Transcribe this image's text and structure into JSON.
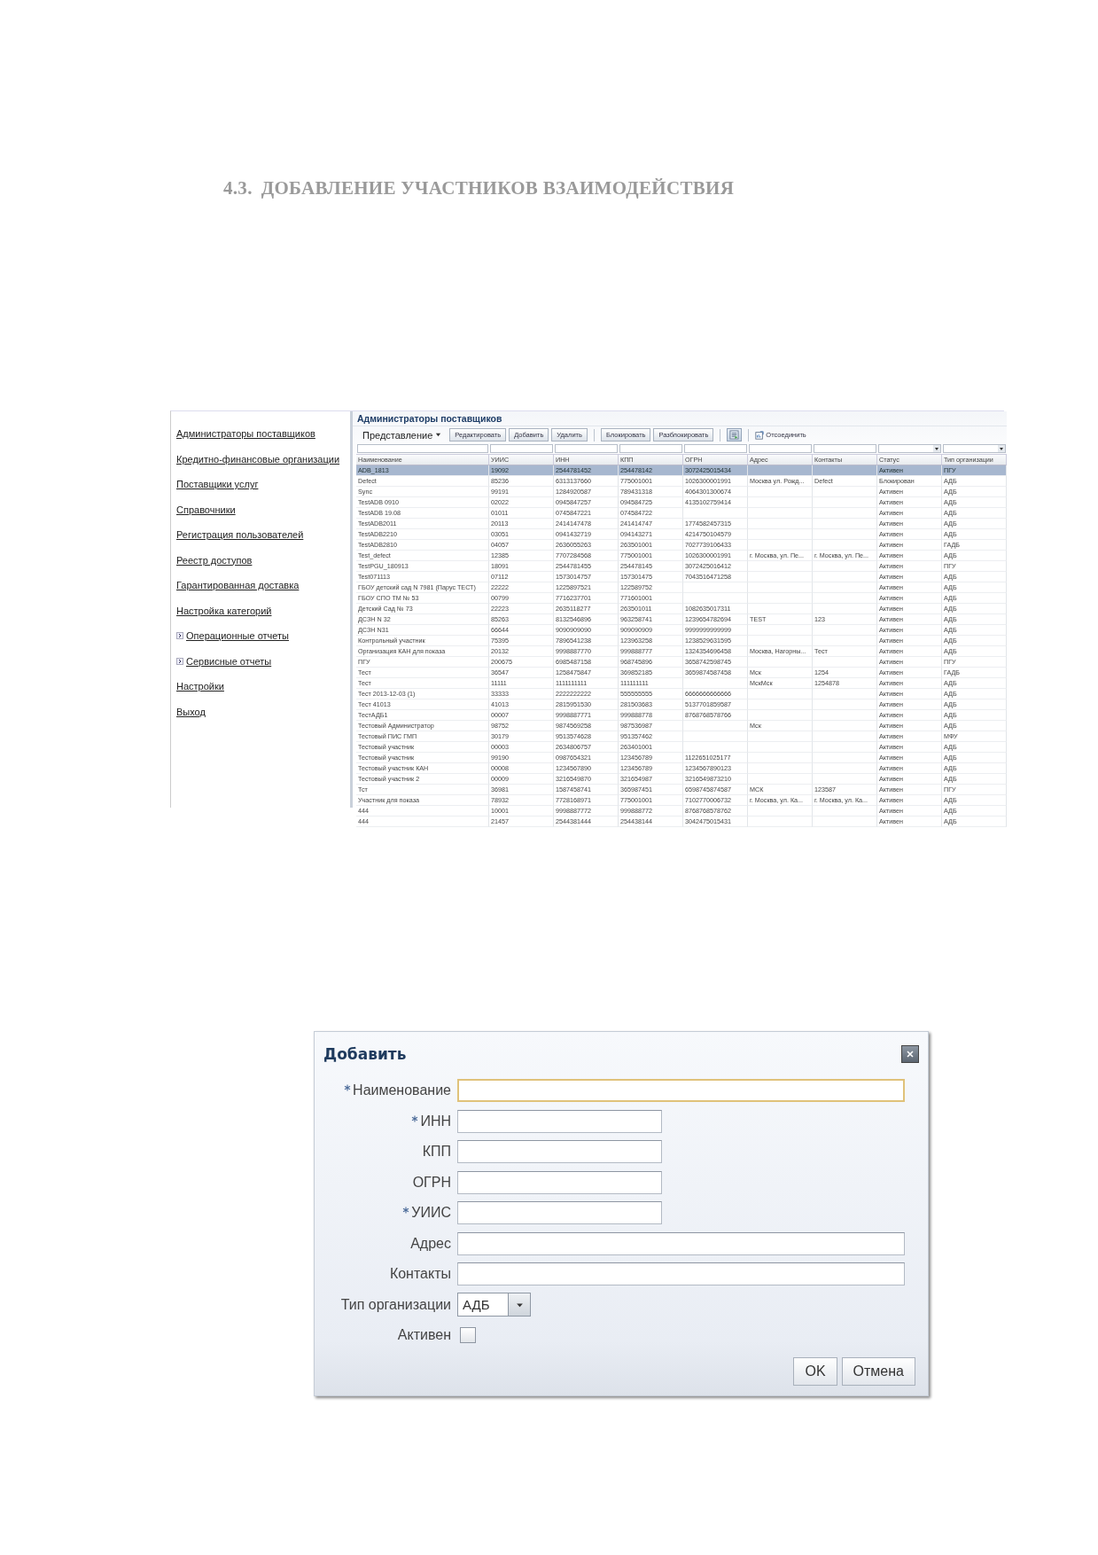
{
  "heading": {
    "number": "4.3.",
    "title": "ДОБАВЛЕНИЕ УЧАСТНИКОВ ВЗАИМОДЕЙСТВИЯ"
  },
  "sidebar": {
    "items": [
      {
        "label": "Администраторы поставщиков",
        "expandable": false
      },
      {
        "label": "Кредитно-финансовые организации",
        "expandable": false
      },
      {
        "label": "Поставщики услуг",
        "expandable": false
      },
      {
        "label": "Справочники",
        "expandable": false
      },
      {
        "label": "Регистрация пользователей",
        "expandable": false
      },
      {
        "label": "Реестр доступов",
        "expandable": false
      },
      {
        "label": "Гарантированная доставка",
        "expandable": false
      },
      {
        "label": "Настройка категорий",
        "expandable": false
      },
      {
        "label": "Операционные отчеты",
        "expandable": true
      },
      {
        "label": "Сервисные отчеты",
        "expandable": true
      },
      {
        "label": "Настройки",
        "expandable": false
      },
      {
        "label": "Выход",
        "expandable": false
      }
    ]
  },
  "panel": {
    "title": "Администраторы поставщиков",
    "toolbar": [
      {
        "kind": "menu",
        "label": "Представление"
      },
      {
        "kind": "button",
        "label": "Редактировать"
      },
      {
        "kind": "button",
        "label": "Добавить"
      },
      {
        "kind": "button",
        "label": "Удалить"
      },
      {
        "kind": "separator"
      },
      {
        "kind": "button",
        "label": "Блокировать"
      },
      {
        "kind": "button",
        "label": "Разблокировать"
      },
      {
        "kind": "separator"
      },
      {
        "kind": "icon"
      },
      {
        "kind": "separator"
      },
      {
        "kind": "icon_label",
        "label": "Отсоединить"
      }
    ],
    "table": {
      "columns": [
        {
          "label": "Наименование",
          "kind": "text"
        },
        {
          "label": "УИИС",
          "kind": "text"
        },
        {
          "label": "ИНН",
          "kind": "text"
        },
        {
          "label": "КПП",
          "kind": "text"
        },
        {
          "label": "ОГРН",
          "kind": "text"
        },
        {
          "label": "Адрес",
          "kind": "text"
        },
        {
          "label": "Контакты",
          "kind": "text"
        },
        {
          "label": "Статус",
          "kind": "select"
        },
        {
          "label": "Тип организации",
          "kind": "select"
        }
      ],
      "rows": [
        {
          "selected": true,
          "cells": [
            "ADB_1813",
            "19092",
            "2544781452",
            "254478142",
            "3072425015434",
            null,
            null,
            "Активен",
            "ПГУ"
          ]
        },
        {
          "selected": false,
          "cells": [
            "Defect",
            "85236",
            "6313137660",
            "775001001",
            "1026300001991",
            "Москва ул. Рожд...",
            "Defect",
            "Блокирован",
            "АДБ"
          ]
        },
        {
          "selected": false,
          "cells": [
            "Sync",
            "99191",
            "1284920587",
            "789431318",
            "4064301300674",
            null,
            null,
            "Активен",
            "АДБ"
          ]
        },
        {
          "selected": false,
          "cells": [
            "TestADB 0910",
            "02022",
            "0945847257",
            "094584725",
            "4135102759414",
            null,
            null,
            "Активен",
            "АДБ"
          ]
        },
        {
          "selected": false,
          "cells": [
            "TestADB 19.08",
            "01011",
            "0745847221",
            "074584722",
            null,
            null,
            null,
            "Активен",
            "АДБ"
          ]
        },
        {
          "selected": false,
          "cells": [
            "TestADB2011",
            "20113",
            "2414147478",
            "241414747",
            "1774582457315",
            null,
            null,
            "Активен",
            "АДБ"
          ]
        },
        {
          "selected": false,
          "cells": [
            "TestADB2210",
            "03051",
            "0941432719",
            "094143271",
            "4214750104579",
            null,
            null,
            "Активен",
            "АДБ"
          ]
        },
        {
          "selected": false,
          "cells": [
            "TestADB2810",
            "04057",
            "2636055263",
            "263501001",
            "7027739106433",
            null,
            null,
            "Активен",
            "ГАДБ"
          ]
        },
        {
          "selected": false,
          "cells": [
            "Test_defect",
            "12385",
            "7707284568",
            "775001001",
            "1026300001991",
            "г. Москва, ул. Пе...",
            "г. Москва, ул. Пе...",
            "Активен",
            "АДБ"
          ]
        },
        {
          "selected": false,
          "cells": [
            "TestPGU_180913",
            "18091",
            "2544781455",
            "254478145",
            "3072425016412",
            null,
            null,
            "Активен",
            "ПГУ"
          ]
        },
        {
          "selected": false,
          "cells": [
            "Test071113",
            "07112",
            "1573014757",
            "157301475",
            "7043516471258",
            null,
            null,
            "Активен",
            "АДБ"
          ]
        },
        {
          "selected": false,
          "cells": [
            "ГБОУ детский сад N 7981 (Парус ТЕСТ)",
            "22222",
            "1225897521",
            "122589752",
            null,
            null,
            null,
            "Активен",
            "АДБ"
          ]
        },
        {
          "selected": false,
          "cells": [
            "ГБОУ СПО ТМ № 53",
            "00799",
            "7716237701",
            "771601001",
            null,
            null,
            null,
            "Активен",
            "АДБ"
          ]
        },
        {
          "selected": false,
          "cells": [
            "Детский Сад № 73",
            "22223",
            "2635118277",
            "263501011",
            "1082635017311",
            null,
            null,
            "Активен",
            "АДБ"
          ]
        },
        {
          "selected": false,
          "cells": [
            "ДСЗН N 32",
            "85263",
            "8132546896",
            "963258741",
            "1239654782694",
            "TEST",
            "123",
            "Активен",
            "АДБ"
          ]
        },
        {
          "selected": false,
          "cells": [
            "ДСЗН N31",
            "66644",
            "9090909090",
            "909090909",
            "9999999999999",
            null,
            null,
            "Активен",
            "АДБ"
          ]
        },
        {
          "selected": false,
          "cells": [
            "Контрольный участник",
            "75395",
            "7896541238",
            "123963258",
            "1238529631595",
            null,
            null,
            "Активен",
            "АДБ"
          ]
        },
        {
          "selected": false,
          "cells": [
            "Организация КАН для показа",
            "20132",
            "9998887770",
            "999888777",
            "1324354696458",
            "Москва, Нагорны...",
            "Тест",
            "Активен",
            "АДБ"
          ]
        },
        {
          "selected": false,
          "cells": [
            "ПГУ",
            "200675",
            "6985487158",
            "968745896",
            "3658742598745",
            null,
            null,
            "Активен",
            "ПГУ"
          ]
        },
        {
          "selected": false,
          "cells": [
            "Тест",
            "36547",
            "1258475847",
            "369852185",
            "3659874587458",
            "Мск",
            "1254",
            "Активен",
            "ГАДБ"
          ]
        },
        {
          "selected": false,
          "cells": [
            "Тест",
            "11111",
            "1111111111",
            "111111111",
            null,
            "МскМск",
            "1254878",
            "Активен",
            "АДБ"
          ]
        },
        {
          "selected": false,
          "cells": [
            "Тест 2013-12-03 (1)",
            "33333",
            "2222222222",
            "555555555",
            "6666666666666",
            null,
            null,
            "Активен",
            "АДБ"
          ]
        },
        {
          "selected": false,
          "cells": [
            "Тест 41013",
            "41013",
            "2815951530",
            "281503683",
            "5137701859587",
            null,
            null,
            "Активен",
            "АДБ"
          ]
        },
        {
          "selected": false,
          "cells": [
            "ТестАДБ1",
            "00007",
            "9998887771",
            "999888778",
            "8768768578766",
            null,
            null,
            "Активен",
            "АДБ"
          ]
        },
        {
          "selected": false,
          "cells": [
            "Тестовый Администратор",
            "98752",
            "9874569258",
            "987536987",
            null,
            "Мск",
            null,
            "Активен",
            "АДБ"
          ]
        },
        {
          "selected": false,
          "cells": [
            "Тестовый ПИС ГМП",
            "30179",
            "9513574628",
            "951357462",
            null,
            null,
            null,
            "Активен",
            "МФУ"
          ]
        },
        {
          "selected": false,
          "cells": [
            "Тестовый участник",
            "00003",
            "2634806757",
            "263401001",
            null,
            null,
            null,
            "Активен",
            "АДБ"
          ]
        },
        {
          "selected": false,
          "cells": [
            "Тестовый участник",
            "99190",
            "0987654321",
            "123456789",
            "1122651025177",
            null,
            null,
            "Активен",
            "АДБ"
          ]
        },
        {
          "selected": false,
          "cells": [
            "Тестовый участник КАН",
            "00008",
            "1234567890",
            "123456789",
            "1234567890123",
            null,
            null,
            "Активен",
            "АДБ"
          ]
        },
        {
          "selected": false,
          "cells": [
            "Тестовый участник 2",
            "00009",
            "3216549870",
            "321654987",
            "3216549873210",
            null,
            null,
            "Активен",
            "АДБ"
          ]
        },
        {
          "selected": false,
          "cells": [
            "Тст",
            "36981",
            "1587458741",
            "365987451",
            "6598745874587",
            "МСК",
            "123587",
            "Активен",
            "ПГУ"
          ]
        },
        {
          "selected": false,
          "cells": [
            "Участник для показа",
            "78932",
            "7728168971",
            "775001001",
            "7102770006732",
            "г. Москва, ул. Ка...",
            "г. Москва, ул. Ка...",
            "Активен",
            "АДБ"
          ]
        },
        {
          "selected": false,
          "cells": [
            "444",
            "10001",
            "9998887772",
            "999888772",
            "8768768578762",
            null,
            null,
            "Активен",
            "АДБ"
          ]
        },
        {
          "selected": false,
          "cells": [
            "444",
            "21457",
            "2544381444",
            "254438144",
            "3042475015431",
            null,
            null,
            "Активен",
            "АДБ"
          ]
        }
      ]
    }
  },
  "dialog": {
    "title": "Добавить",
    "fields": [
      {
        "kind": "text",
        "label": "Наименование",
        "required": true,
        "wide": true,
        "focused": true
      },
      {
        "kind": "text",
        "label": "ИНН",
        "required": true,
        "wide": false,
        "focused": false
      },
      {
        "kind": "text",
        "label": "КПП",
        "required": false,
        "wide": false,
        "focused": false
      },
      {
        "kind": "text",
        "label": "ОГРН",
        "required": false,
        "wide": false,
        "focused": false
      },
      {
        "kind": "text",
        "label": "УИИС",
        "required": true,
        "wide": false,
        "focused": false
      },
      {
        "kind": "text",
        "label": "Адрес",
        "required": false,
        "wide": true,
        "focused": false
      },
      {
        "kind": "text",
        "label": "Контакты",
        "required": false,
        "wide": true,
        "focused": false
      },
      {
        "kind": "select",
        "label": "Тип организации",
        "required": false,
        "value": "АДБ"
      },
      {
        "kind": "checkbox",
        "label": "Активен",
        "required": false,
        "checked": false
      }
    ],
    "buttons": [
      "OK",
      "Отмена"
    ]
  }
}
